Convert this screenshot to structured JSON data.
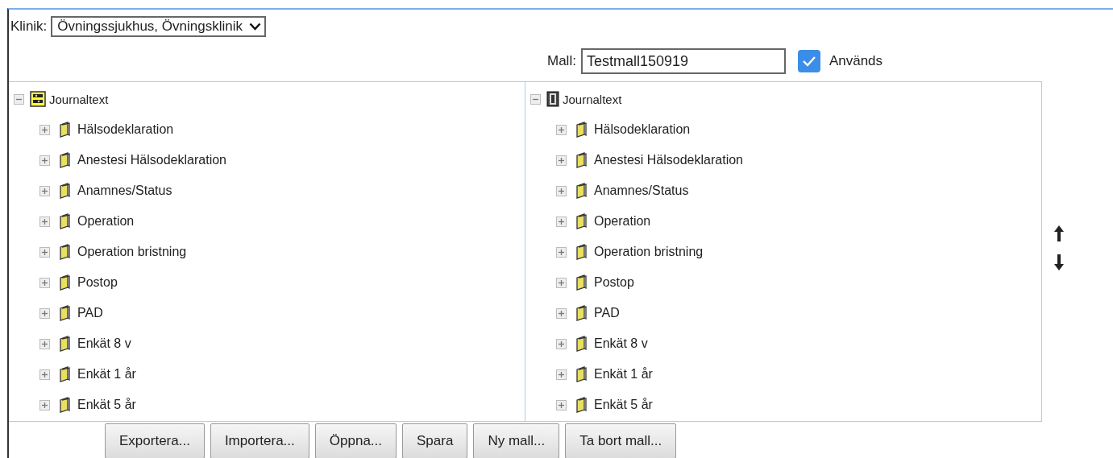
{
  "klinik": {
    "label": "Klinik:",
    "value": "Övningssjukhus, Övningsklinik"
  },
  "mall": {
    "label": "Mall:",
    "value": "Testmall150919"
  },
  "anvands": {
    "label": "Används",
    "checked": true
  },
  "trees": [
    {
      "kind": "template",
      "label": "Journaltext",
      "expanded": true,
      "children": [
        {
          "label": "Hälsodeklaration",
          "expanded": false
        },
        {
          "label": "Anestesi Hälsodeklaration",
          "expanded": false
        },
        {
          "label": "Anamnes/Status",
          "expanded": false
        },
        {
          "label": "Operation",
          "expanded": false
        },
        {
          "label": "Operation bristning",
          "expanded": false
        },
        {
          "label": "Postop",
          "expanded": false
        },
        {
          "label": "PAD",
          "expanded": false
        },
        {
          "label": "Enkät 8 v",
          "expanded": false
        },
        {
          "label": "Enkät 1 år",
          "expanded": false
        },
        {
          "label": "Enkät 5 år",
          "expanded": false
        }
      ]
    },
    {
      "kind": "document",
      "label": "Journaltext",
      "expanded": true,
      "children": [
        {
          "label": "Hälsodeklaration",
          "expanded": false
        },
        {
          "label": "Anestesi Hälsodeklaration",
          "expanded": false
        },
        {
          "label": "Anamnes/Status",
          "expanded": false
        },
        {
          "label": "Operation",
          "expanded": false
        },
        {
          "label": "Operation bristning",
          "expanded": false
        },
        {
          "label": "Postop",
          "expanded": false
        },
        {
          "label": "PAD",
          "expanded": false
        },
        {
          "label": "Enkät 8 v",
          "expanded": false
        },
        {
          "label": "Enkät 1 år",
          "expanded": false
        },
        {
          "label": "Enkät 5 år",
          "expanded": false
        }
      ]
    }
  ],
  "buttons": [
    "Exportera...",
    "Importera...",
    "Öppna...",
    "Spara",
    "Ny mall...",
    "Ta bort mall..."
  ]
}
